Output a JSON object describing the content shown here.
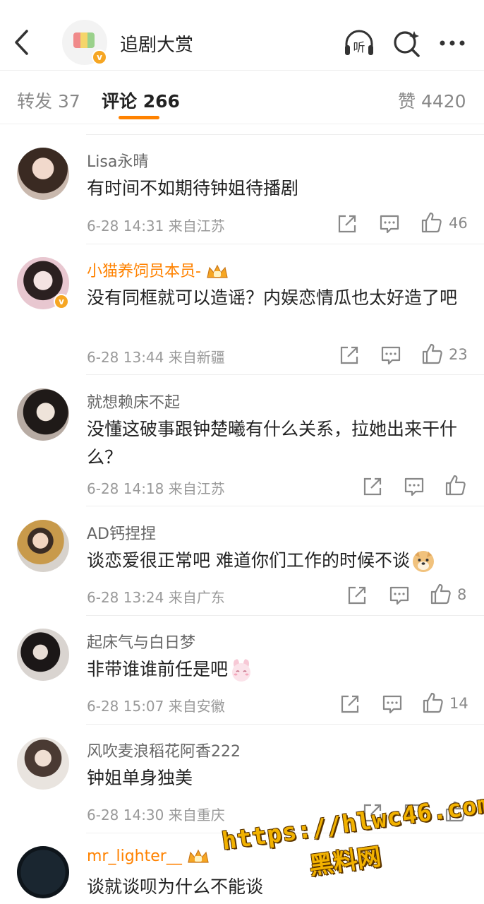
{
  "header": {
    "title": "追剧大赏",
    "back_icon": "chevron-left-icon",
    "listen_icon": "headphones-listen-icon",
    "listen_label": "听",
    "search_icon": "search-sparkle-icon",
    "more_icon": "more-horizontal-icon"
  },
  "tabs": {
    "repost_label": "转发",
    "repost_count": "37",
    "comment_label": "评论",
    "comment_count": "266",
    "like_label": "赞",
    "like_count": "4420"
  },
  "colors": {
    "accent": "#ff8200",
    "verified": "#f6a623",
    "vip_name": "#ff8200"
  },
  "comments": [
    {
      "user": "Lisa永晴",
      "text": "有时间不如期待钟姐待播剧",
      "time": "6-28 14:31",
      "location": "来自江苏",
      "likes": "46"
    },
    {
      "user": "小猫养饲员本员-",
      "text": "没有同框就可以造谣？内娱恋情瓜也太好造了吧",
      "time": "6-28 13:44",
      "location": "来自新疆",
      "likes": "23"
    },
    {
      "user": "就想赖床不起",
      "text": "没懂这破事跟钟楚曦有什么关系，拉她出来干什么？",
      "time": "6-28 14:18",
      "location": "来自江苏",
      "likes": ""
    },
    {
      "user": "AD钙捏捏",
      "text": "谈恋爱很正常吧 难道你们工作的时候不谈",
      "time": "6-28 13:24",
      "location": "来自广东",
      "likes": "8"
    },
    {
      "user": "起床气与白日梦",
      "text": "非带谁谁前任是吧",
      "time": "6-28 15:07",
      "location": "来自安徽",
      "likes": "14"
    },
    {
      "user": "风吹麦浪稻花阿香222",
      "text": "钟姐单身独美",
      "time": "6-28 14:30",
      "location": "来自重庆",
      "likes": ""
    },
    {
      "user": "mr_lighter__",
      "text": "谈就谈呗为什么不能谈",
      "time": "",
      "location": "",
      "likes": ""
    }
  ],
  "watermark": {
    "line1": "https://hlwc46.com",
    "line2": "黑料网"
  }
}
